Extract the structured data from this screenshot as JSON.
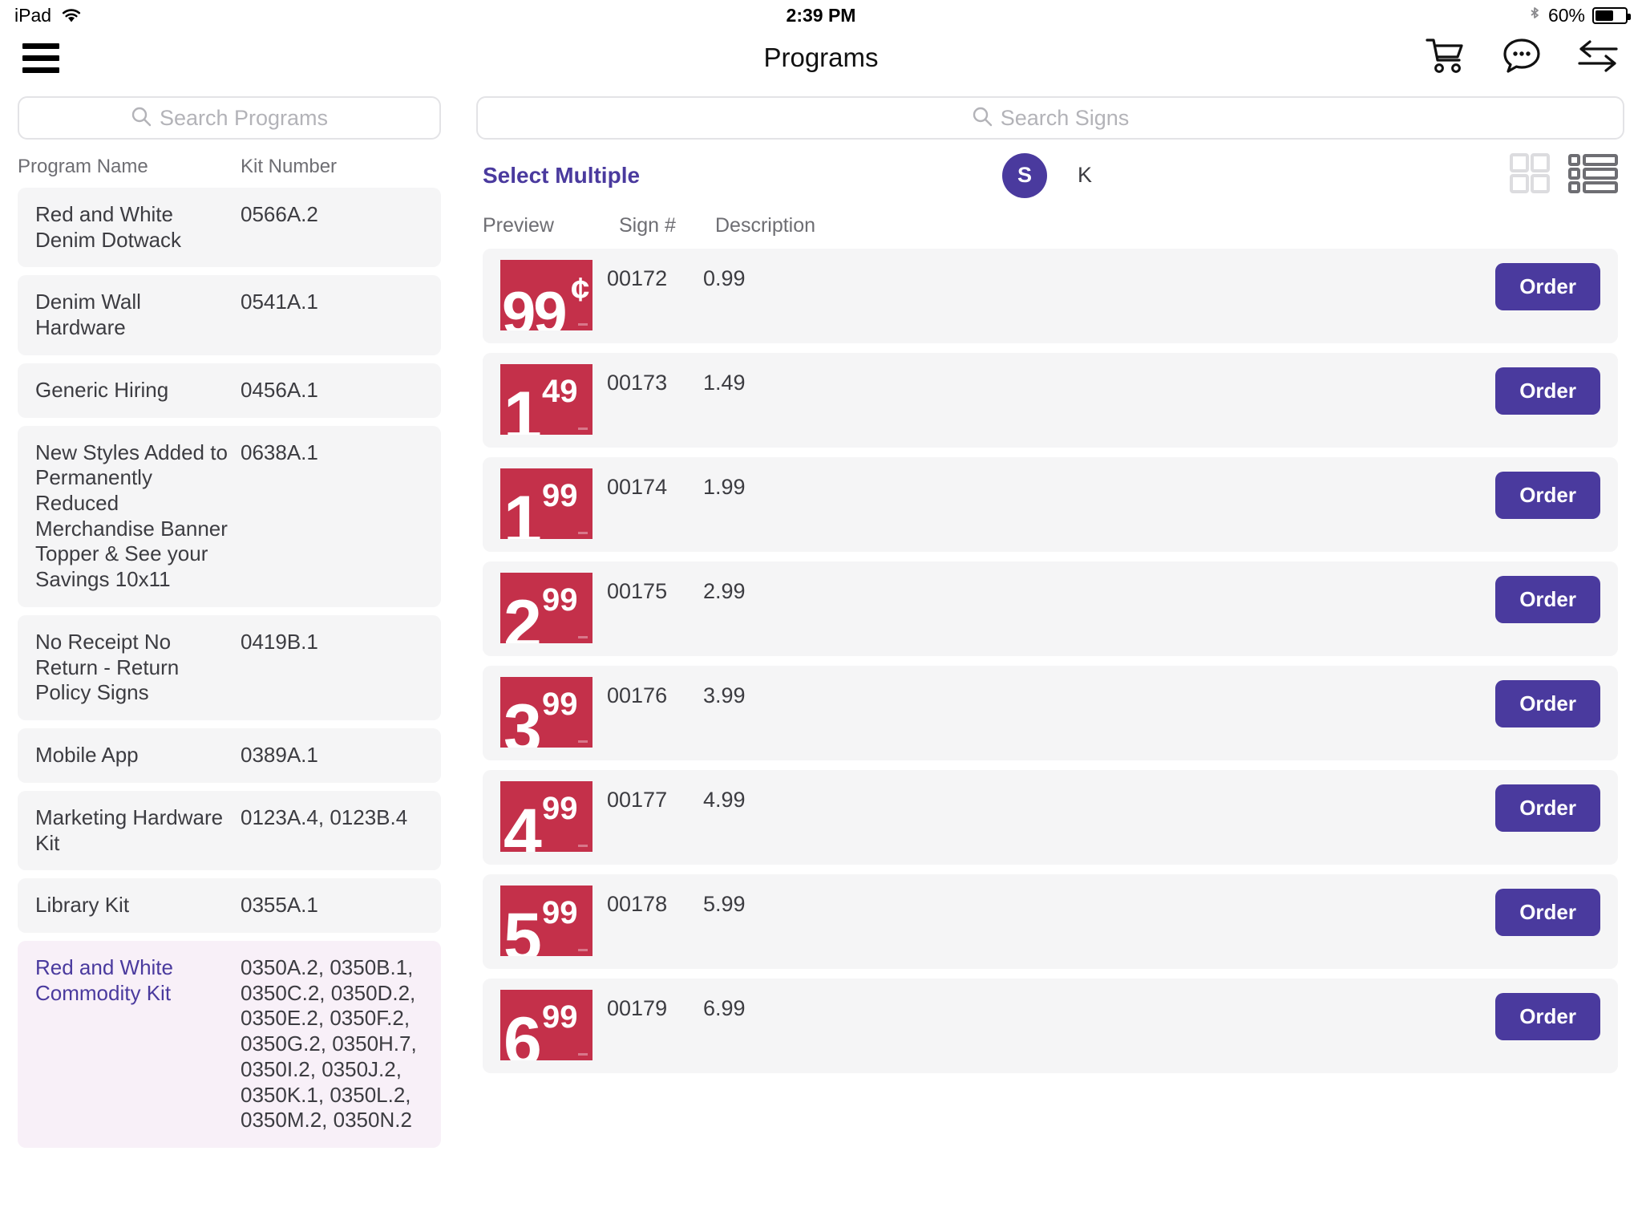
{
  "statusbar": {
    "device": "iPad",
    "wifi_icon": "wifi-icon",
    "time": "2:39 PM",
    "bluetooth_icon": "bluetooth-icon",
    "battery_pct": "60%",
    "battery_level": 60
  },
  "navbar": {
    "menu_icon": "hamburger-menu-icon",
    "title": "Programs",
    "actions": [
      {
        "name": "cart-icon",
        "label": "Cart"
      },
      {
        "name": "chat-icon",
        "label": "Messages"
      },
      {
        "name": "transfer-icon",
        "label": "Transfer"
      }
    ]
  },
  "left_pane": {
    "search": {
      "placeholder": "Search Programs",
      "value": "",
      "icon": "search-icon"
    },
    "columns": {
      "name": "Program Name",
      "kit": "Kit Number"
    },
    "programs": [
      {
        "name": "Red and White Denim Dotwack",
        "kit": "0566A.2",
        "selected": false
      },
      {
        "name": "Denim Wall Hardware",
        "kit": "0541A.1",
        "selected": false
      },
      {
        "name": "Generic Hiring",
        "kit": "0456A.1",
        "selected": false
      },
      {
        "name": "New Styles Added to Permanently Reduced Merchandise Banner Topper & See your Savings 10x11",
        "kit": "0638A.1",
        "selected": false
      },
      {
        "name": "No Receipt No Return - Return Policy Signs",
        "kit": "0419B.1",
        "selected": false
      },
      {
        "name": "Mobile App",
        "kit": "0389A.1",
        "selected": false
      },
      {
        "name": "Marketing Hardware Kit",
        "kit": "0123A.4, 0123B.4",
        "selected": false
      },
      {
        "name": "Library Kit",
        "kit": "0355A.1",
        "selected": false
      },
      {
        "name": "Red and White Commodity Kit",
        "kit": "0350A.2, 0350B.1, 0350C.2, 0350D.2, 0350E.2, 0350F.2, 0350G.2, 0350H.7, 0350I.2, 0350J.2, 0350K.1, 0350L.2, 0350M.2, 0350N.2",
        "selected": true
      }
    ]
  },
  "right_pane": {
    "search": {
      "placeholder": "Search Signs",
      "value": "",
      "icon": "search-icon"
    },
    "toolbar": {
      "select_multiple_label": "Select Multiple",
      "toggle_s": "S",
      "toggle_k": "K",
      "grid_view_icon": "grid-view-icon",
      "list_view_icon": "list-view-icon",
      "active_view": "list"
    },
    "columns": {
      "preview": "Preview",
      "sign": "Sign #",
      "description": "Description"
    },
    "order_label": "Order",
    "signs": [
      {
        "sign": "00172",
        "description": "0.99",
        "price_big": "99",
        "price_sup": "¢",
        "cents_style": true
      },
      {
        "sign": "00173",
        "description": "1.49",
        "price_big": "1",
        "price_sup": "49",
        "cents_style": false
      },
      {
        "sign": "00174",
        "description": "1.99",
        "price_big": "1",
        "price_sup": "99",
        "cents_style": false
      },
      {
        "sign": "00175",
        "description": "2.99",
        "price_big": "2",
        "price_sup": "99",
        "cents_style": false
      },
      {
        "sign": "00176",
        "description": "3.99",
        "price_big": "3",
        "price_sup": "99",
        "cents_style": false
      },
      {
        "sign": "00177",
        "description": "4.99",
        "price_big": "4",
        "price_sup": "99",
        "cents_style": false
      },
      {
        "sign": "00178",
        "description": "5.99",
        "price_big": "5",
        "price_sup": "99",
        "cents_style": false
      },
      {
        "sign": "00179",
        "description": "6.99",
        "price_big": "6",
        "price_sup": "99",
        "cents_style": false
      }
    ]
  },
  "colors": {
    "accent_purple": "#4a3a9e",
    "sign_red": "#c4304a",
    "row_gray": "#f5f5f6",
    "selected_row": "#f8f0f8",
    "text_dark": "#3c3c41",
    "text_muted": "#6e6e73"
  }
}
